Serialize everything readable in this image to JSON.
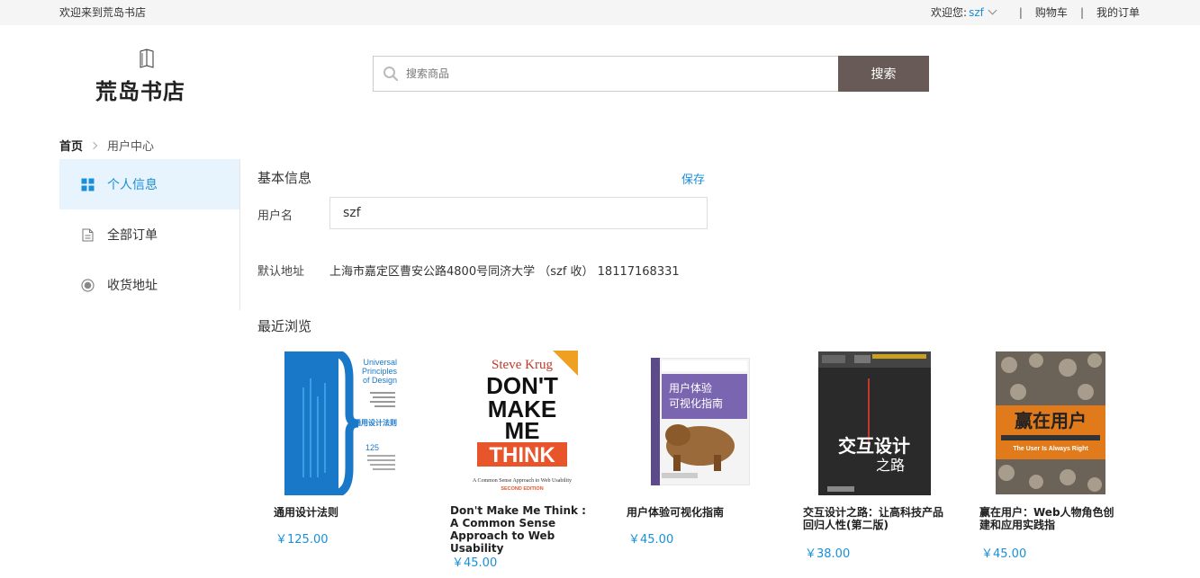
{
  "topbar": {
    "welcome": "欢迎来到荒岛书店",
    "greeting": "欢迎您:",
    "username": "szf",
    "cart": "购物车",
    "orders": "我的订单",
    "separator": "|"
  },
  "logo": {
    "name": "荒岛书店"
  },
  "search": {
    "placeholder": "搜索商品",
    "button": "搜索"
  },
  "breadcrumb": {
    "home": "首页",
    "current": "用户中心"
  },
  "sidebar": {
    "items": [
      {
        "label": "个人信息",
        "icon": "grid-icon",
        "active": true
      },
      {
        "label": "全部订单",
        "icon": "document-icon",
        "active": false
      },
      {
        "label": "收货地址",
        "icon": "location-icon",
        "active": false
      }
    ]
  },
  "basic_info": {
    "title": "基本信息",
    "save": "保存",
    "username_label": "用户名",
    "username_value": "szf",
    "address_label": "默认地址",
    "address_value": "上海市嘉定区曹安公路4800号同济大学 （szf 收） 18117168331"
  },
  "recent": {
    "title": "最近浏览",
    "books": [
      {
        "title": "通用设计法则",
        "price": "￥125.00",
        "cover_text": "Universal Principles of Design"
      },
      {
        "title": "Don't Make Me Think : A Common Sense Approach to Web Usability",
        "price": "￥45.00",
        "cover_text": "Steve Krug DON'T MAKE ME THINK"
      },
      {
        "title": "用户体验可视化指南",
        "price": "￥45.00",
        "cover_text": "用户体验可视化指南"
      },
      {
        "title": "交互设计之路：让高科技产品回归人性(第二版)",
        "price": "￥38.00",
        "cover_text": "交互设计之路"
      },
      {
        "title": "赢在用户：Web人物角色创建和应用实践指",
        "price": "￥45.00",
        "cover_text": "赢在用户"
      }
    ]
  },
  "colors": {
    "accent": "#1a8fd8",
    "search_button": "#675a57",
    "active_bg": "#e8f4fd"
  }
}
